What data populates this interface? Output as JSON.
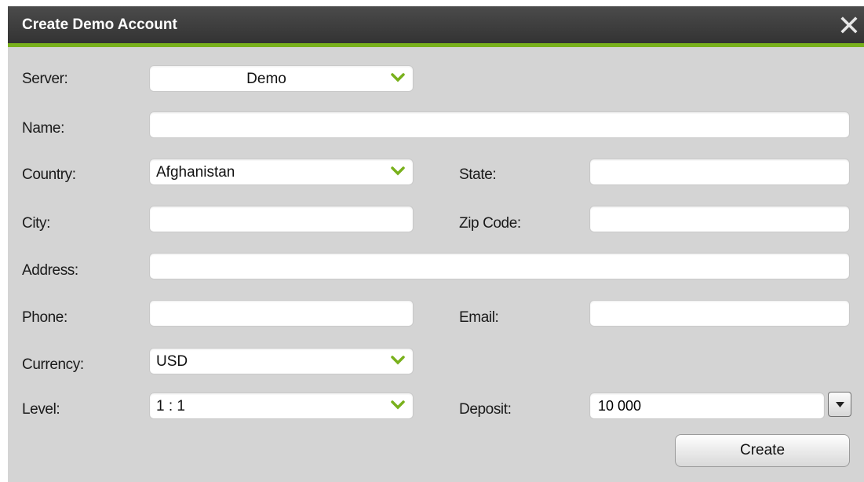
{
  "dialog": {
    "title": "Create Demo Account"
  },
  "labels": {
    "server": "Server:",
    "name": "Name:",
    "country": "Country:",
    "state": "State:",
    "city": "City:",
    "zip": "Zip Code:",
    "address": "Address:",
    "phone": "Phone:",
    "email": "Email:",
    "currency": "Currency:",
    "level": "Level:",
    "deposit": "Deposit:"
  },
  "values": {
    "server": "Demo",
    "country": "Afghanistan",
    "currency": "USD",
    "level": "1 : 1",
    "deposit": "10 000",
    "name": "",
    "state": "",
    "city": "",
    "zip": "",
    "address": "",
    "phone": "",
    "email": ""
  },
  "buttons": {
    "create": "Create"
  },
  "icons": {
    "close": "close-icon",
    "dropdown": "chevron-down-icon",
    "spin": "triangle-down-icon"
  },
  "colors": {
    "accent": "#79b11c",
    "titlebar": "#3a3a3a",
    "panel": "#d4d4d4"
  }
}
